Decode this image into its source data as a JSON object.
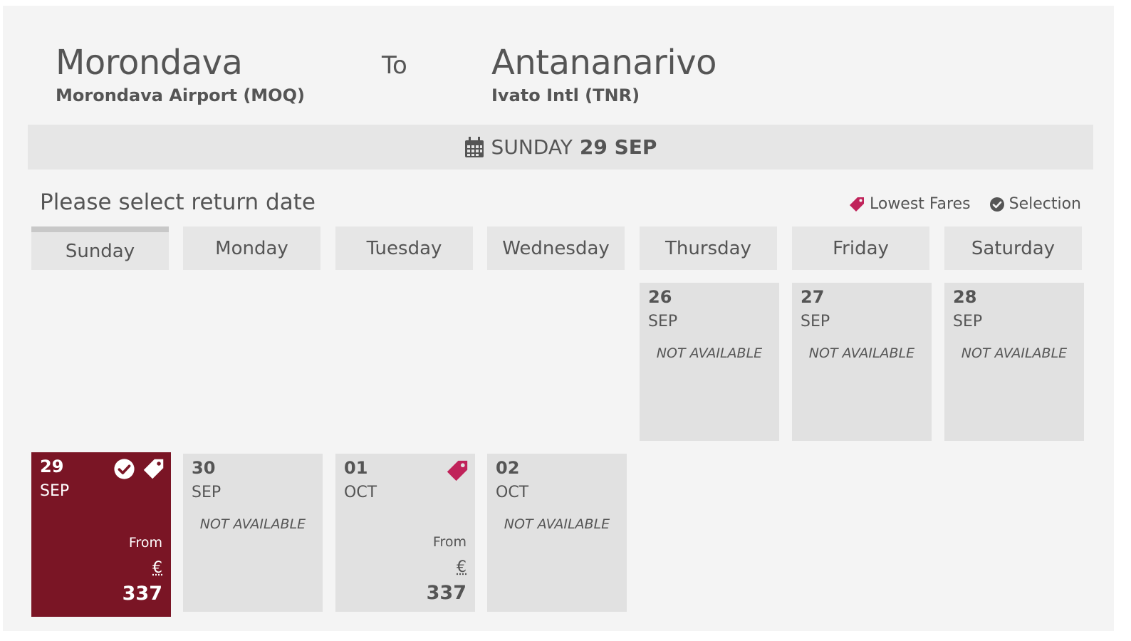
{
  "route": {
    "origin_city": "Morondava",
    "origin_airport": "Morondava Airport (MOQ)",
    "to_label": "To",
    "destination_city": "Antananarivo",
    "destination_airport": "Ivato Intl (TNR)"
  },
  "outbound": {
    "weekday": "SUNDAY",
    "date": "29 SEP"
  },
  "instruction": "Please select return date",
  "legend": {
    "lowest_fares": "Lowest Fares",
    "selection": "Selection"
  },
  "weekdays": [
    "Sunday",
    "Monday",
    "Tuesday",
    "Wednesday",
    "Thursday",
    "Friday",
    "Saturday"
  ],
  "days": [
    {
      "day": "26",
      "month": "SEP",
      "status": "NOT AVAILABLE"
    },
    {
      "day": "27",
      "month": "SEP",
      "status": "NOT AVAILABLE"
    },
    {
      "day": "28",
      "month": "SEP",
      "status": "NOT AVAILABLE"
    },
    {
      "day": "29",
      "month": "SEP",
      "from": "From",
      "currency": "€",
      "price": "337",
      "selected": true,
      "lowest_fare": true
    },
    {
      "day": "30",
      "month": "SEP",
      "status": "NOT AVAILABLE"
    },
    {
      "day": "01",
      "month": "OCT",
      "from": "From",
      "currency": "€",
      "price": "337",
      "lowest_fare": true
    },
    {
      "day": "02",
      "month": "OCT",
      "status": "NOT AVAILABLE"
    }
  ],
  "colors": {
    "selected_bg": "#7a1525",
    "lowest_fare_tag": "#c0235a",
    "cell_bg": "#e1e1e1",
    "header_bg": "#e6e6e6",
    "text": "#555555"
  },
  "icons": {
    "calendar": "calendar-icon",
    "tag": "price-tag-icon",
    "check": "check-circle-icon"
  }
}
